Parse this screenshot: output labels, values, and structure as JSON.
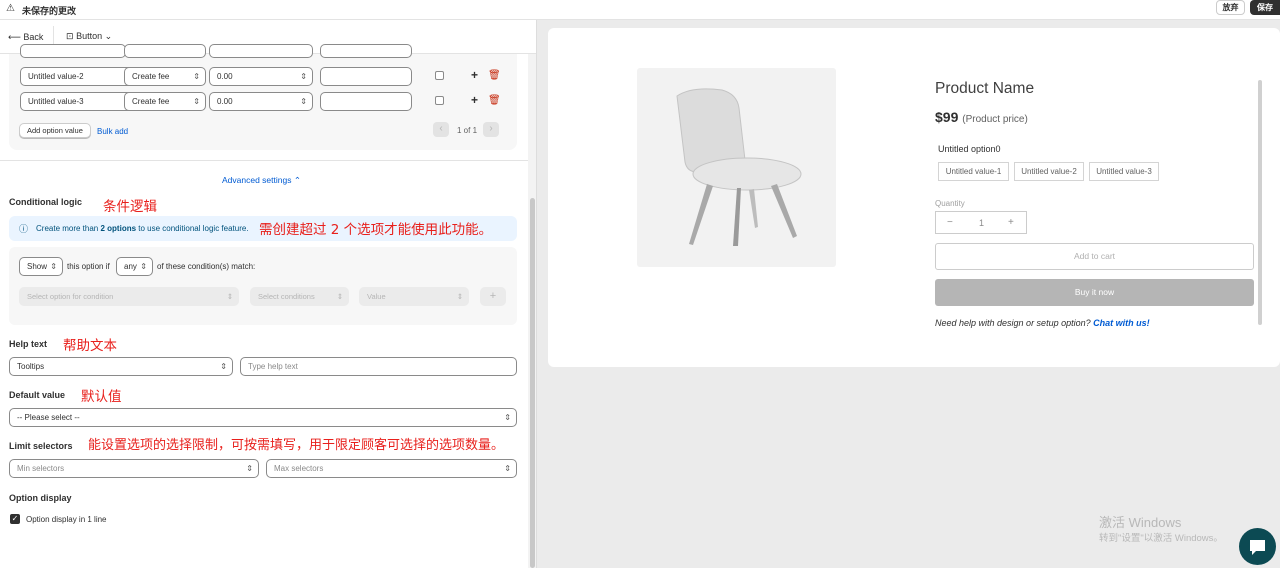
{
  "topbar": {
    "title": "未保存的更改",
    "discard_label": "放弃",
    "save_label": "保存"
  },
  "toolbar": {
    "back_label": "Back",
    "type_label": "Button"
  },
  "option_values": {
    "rows": [
      {
        "name": "Untitled value-2",
        "fee_type": "Create fee",
        "price": "0.00"
      },
      {
        "name": "Untitled value-3",
        "fee_type": "Create fee",
        "price": "0.00"
      }
    ],
    "add_button": "Add option value",
    "bulk_add": "Bulk add",
    "pagination": "1 of 1"
  },
  "advanced_settings": "Advanced settings ⌃",
  "conditional_logic": {
    "title": "Conditional logic",
    "annotation": "条件逻辑",
    "banner_pre": "Create more than ",
    "banner_bold": "2 options",
    "banner_post": " to use conditional logic feature.",
    "banner_annotation": "需创建超过 2 个选项才能使用此功能。",
    "action_value": "Show",
    "this_option_if": "this option if",
    "match_value": "any",
    "match_suffix": "of these condition(s) match:",
    "select_option_placeholder": "Select option for condition",
    "select_conditions_placeholder": "Select conditions",
    "value_placeholder": "Value",
    "add_label": "+"
  },
  "help_text": {
    "title": "Help text",
    "annotation": "帮助文本",
    "mode": "Tooltips",
    "placeholder": "Type help text"
  },
  "default_value": {
    "title": "Default value",
    "annotation": "默认值",
    "selected": "-- Please select --"
  },
  "limit_selectors": {
    "title": "Limit selectors",
    "annotation": "能设置选项的选择限制，可按需填写，用于限定顾客可选择的选项数量。",
    "min_placeholder": "Min selectors",
    "max_placeholder": "Max selectors"
  },
  "option_display": {
    "title": "Option display",
    "checkbox_label": "Option display in 1 line"
  },
  "preview": {
    "product_name": "Product Name",
    "price": "$99",
    "price_note": "(Product price)",
    "option_label": "Untitled option0",
    "chips": [
      "Untitled value-1",
      "Untitled value-2",
      "Untitled value-3"
    ],
    "quantity_label": "Quantity",
    "quantity_value": "1",
    "add_to_cart": "Add to cart",
    "buy_now": "Buy it now",
    "help_text": "Need help with design or setup option?",
    "help_link": "Chat with us!"
  },
  "watermark": {
    "line1": "激活 Windows",
    "line2": "转到\"设置\"以激活 Windows。"
  },
  "colors": {
    "accent": "#005bd3",
    "annotation": "#e8201c",
    "danger": "#c5280c"
  }
}
